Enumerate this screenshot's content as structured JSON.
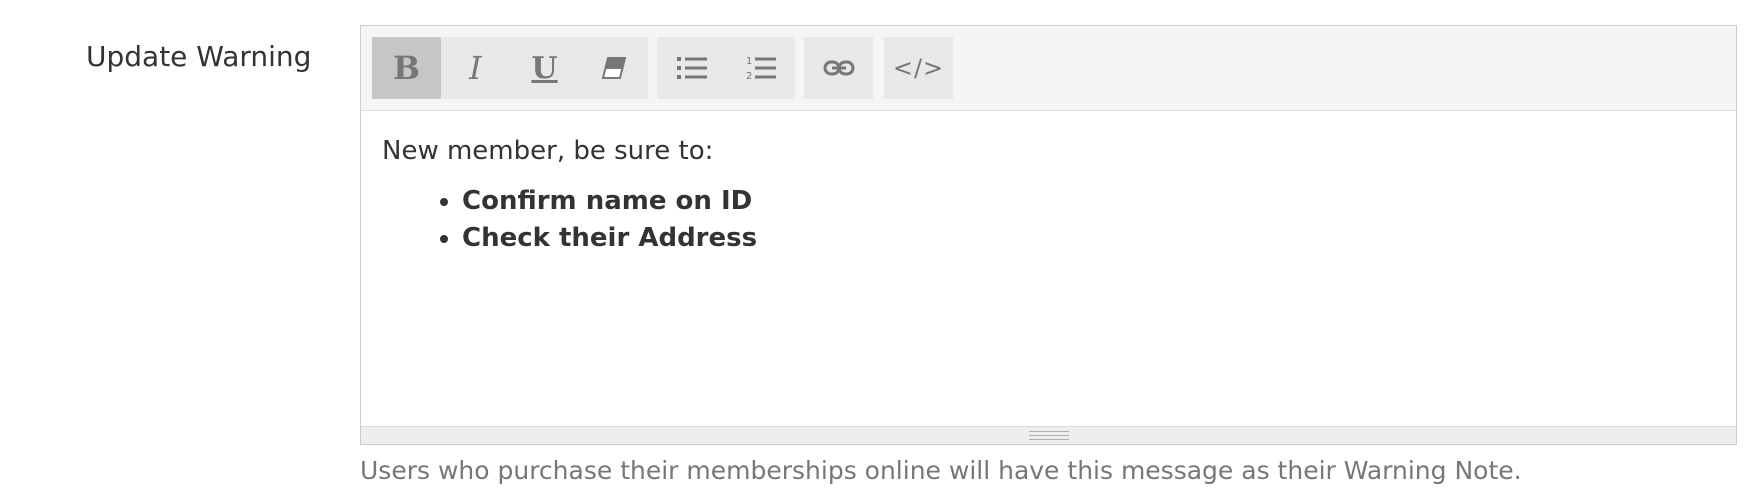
{
  "field": {
    "label": "Update Warning",
    "help_text": "Users who purchase their memberships online will have this message as their Warning Note."
  },
  "toolbar": {
    "groups": [
      [
        {
          "name": "bold",
          "label": "B",
          "icon": "bold-icon",
          "active": true
        },
        {
          "name": "italic",
          "label": "I",
          "icon": "italic-icon",
          "active": false
        },
        {
          "name": "underline",
          "label": "U",
          "icon": "underline-icon",
          "active": false
        },
        {
          "name": "clear-format",
          "icon": "eraser-icon",
          "active": false
        }
      ],
      [
        {
          "name": "bullet-list",
          "icon": "unordered-list-icon",
          "active": false
        },
        {
          "name": "numbered-list",
          "icon": "ordered-list-icon",
          "active": false
        }
      ],
      [
        {
          "name": "link",
          "icon": "link-icon",
          "active": false
        }
      ],
      [
        {
          "name": "code-view",
          "label": "</>",
          "icon": "code-icon",
          "active": false
        }
      ]
    ]
  },
  "editor": {
    "paragraph": "New member, be sure to:",
    "bullets": [
      "Confirm name on ID",
      "Check their Address"
    ]
  },
  "colors": {
    "toolbar_bg": "#f5f5f5",
    "button_bg": "#e8e8e8",
    "button_active_bg": "#c6c6c6",
    "icon": "#777777",
    "text": "#333333",
    "help_text": "#777777"
  }
}
